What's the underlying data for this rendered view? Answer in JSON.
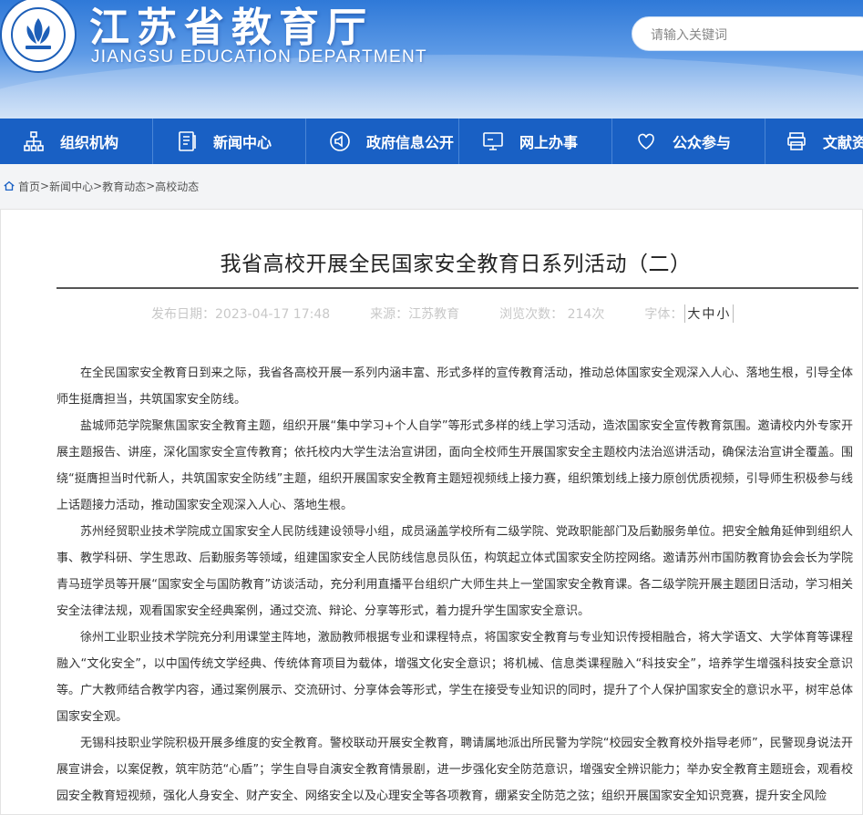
{
  "header": {
    "title": "江苏省教育厅",
    "subtitle": "JIANGSU EDUCATION DEPARTMENT",
    "search_placeholder": "请输入关键词"
  },
  "nav": {
    "items": [
      {
        "label": "组织机构",
        "icon": "org-chart-icon"
      },
      {
        "label": "新闻中心",
        "icon": "document-icon"
      },
      {
        "label": "政府信息公开",
        "icon": "speaker-icon"
      },
      {
        "label": "网上办事",
        "icon": "monitor-icon"
      },
      {
        "label": "公众参与",
        "icon": "heart-icon"
      },
      {
        "label": "文献资",
        "icon": "printer-icon"
      }
    ]
  },
  "breadcrumb": [
    "首页",
    "新闻中心",
    "教育动态",
    "高校动态"
  ],
  "article": {
    "title": "我省高校开展全民国家安全教育日系列活动（二）",
    "publish_date": "发布日期：2023-04-17 17:48",
    "source": "来源：江苏教育",
    "views": "浏览次数： 214次",
    "font_label": "字体：",
    "font_sizes": [
      "大",
      "中",
      "小"
    ],
    "paragraphs": [
      "在全民国家安全教育日到来之际，我省各高校开展一系列内涵丰富、形式多样的宣传教育活动，推动总体国家安全观深入人心、落地生根，引导全体师生挺膺担当，共筑国家安全防线。",
      "盐城师范学院聚焦国家安全教育主题，组织开展“集中学习+个人自学”等形式多样的线上学习活动，造浓国家安全宣传教育氛围。邀请校内外专家开展主题报告、讲座，深化国家安全宣传教育；依托校内大学生法治宣讲团，面向全校师生开展国家安全主题校内法治巡讲活动，确保法治宣讲全覆盖。围绕“挺膺担当时代新人，共筑国家安全防线”主题，组织开展国家安全教育主题短视频线上接力赛，组织策划线上接力原创优质视频，引导师生积极参与线上话题接力活动，推动国家安全观深入人心、落地生根。",
      "苏州经贸职业技术学院成立国家安全人民防线建设领导小组，成员涵盖学校所有二级学院、党政职能部门及后勤服务单位。把安全触角延伸到组织人事、教学科研、学生思政、后勤服务等领域，组建国家安全人民防线信息员队伍，构筑起立体式国家安全防控网络。邀请苏州市国防教育协会会长为学院青马班学员等开展“国家安全与国防教育”访谈活动，充分利用直播平台组织广大师生共上一堂国家安全教育课。各二级学院开展主题团日活动，学习相关安全法律法规，观看国家安全经典案例，通过交流、辩论、分享等形式，着力提升学生国家安全意识。",
      "徐州工业职业技术学院充分利用课堂主阵地，激励教师根据专业和课程特点，将国家安全教育与专业知识传授相融合，将大学语文、大学体育等课程融入“文化安全”，以中国传统文学经典、传统体育项目为载体，增强文化安全意识；将机械、信息类课程融入“科技安全”，培养学生增强科技安全意识等。广大教师结合教学内容，通过案例展示、交流研讨、分享体会等形式，学生在接受专业知识的同时，提升了个人保护国家安全的意识水平，树牢总体国家安全观。",
      "无锡科技职业学院积极开展多维度的安全教育。警校联动开展安全教育，聘请属地派出所民警为学院“校园安全教育校外指导老师”，民警现身说法开展宣讲会，以案促教，筑牢防范“心盾”；学生自导自演安全教育情景剧，进一步强化安全防范意识，增强安全辨识能力；举办安全教育主题班会，观看校园安全教育短视频，强化人身安全、财产安全、网络安全以及心理安全等各项教育，绷紧安全防范之弦；组织开展国家安全知识竞赛，提升安全风险"
    ]
  },
  "colors": {
    "nav_bg": "#1960c4",
    "header_top": "#2f79d8",
    "header_bottom": "#c9def6"
  }
}
